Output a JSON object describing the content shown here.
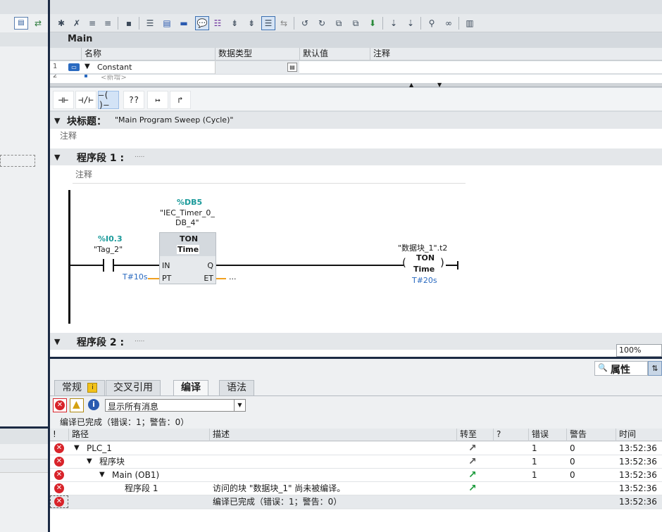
{
  "editor_header": {
    "block_name": "Main"
  },
  "interface": {
    "columns": [
      "名称",
      "数据类型",
      "默认值",
      "注释"
    ],
    "rows": [
      {
        "num": "1",
        "name": "Constant"
      },
      {
        "num": "2",
        "name": "<新增>"
      }
    ]
  },
  "lad_toolbar": [
    "⊣⊢",
    "⊣/⊢",
    "–( )–",
    "??",
    "↦",
    "↱"
  ],
  "block_title": {
    "label": "块标题：",
    "value": "\"Main Program Sweep (Cycle)\"",
    "comment": "注释"
  },
  "network1": {
    "label": "程序段 1 :",
    "title": ".....",
    "comment": "注释",
    "contact": {
      "address": "%I0.3",
      "tag": "\"Tag_2\""
    },
    "timer": {
      "db_address": "%DB5",
      "db_name_line1": "\"IEC_Timer_0_",
      "db_name_line2": "DB_4\"",
      "type": "TON",
      "time_label": "Time",
      "pin_in": "IN",
      "pin_pt": "PT",
      "pin_q": "Q",
      "pin_et": "ET",
      "pt_value": "T#10s",
      "et_value": "..."
    },
    "coil": {
      "tag": "\"数据块_1\".t2",
      "type": "TON",
      "time_label": "Time",
      "value": "T#20s"
    }
  },
  "network2": {
    "label": "程序段 2 :",
    "title": "....."
  },
  "zoom": "100%",
  "properties_button": "属性",
  "inspector_tabs": [
    {
      "label": "常规",
      "active": false
    },
    {
      "label": "交叉引用",
      "active": false
    },
    {
      "label": "编译",
      "active": true
    },
    {
      "label": "语法",
      "active": false
    }
  ],
  "filter": {
    "selected": "显示所有消息"
  },
  "compile_summary": "编译已完成（错误：1；警告：0）",
  "grid": {
    "columns": [
      "!",
      "路径",
      "描述",
      "转至",
      "?",
      "错误",
      "警告",
      "时间"
    ],
    "rows": [
      {
        "path": "PLC_1",
        "indent": 1,
        "expand": true,
        "desc": "",
        "goto": true,
        "errors": "1",
        "warnings": "0",
        "time": "13:52:36"
      },
      {
        "path": "程序块",
        "indent": 2,
        "expand": true,
        "desc": "",
        "goto": true,
        "errors": "1",
        "warnings": "0",
        "time": "13:52:36"
      },
      {
        "path": "Main (OB1)",
        "indent": 3,
        "expand": true,
        "desc": "",
        "goto": true,
        "errors": "1",
        "warnings": "0",
        "time": "13:52:36"
      },
      {
        "path": "程序段 1",
        "indent": 4,
        "expand": false,
        "desc": "访问的块 \"数据块_1\" 尚未被编译。",
        "goto": true,
        "errors": "",
        "warnings": "",
        "time": "13:52:36"
      },
      {
        "path": "",
        "indent": 0,
        "expand": false,
        "desc": "编译已完成（错误：1；警告：0）",
        "goto": false,
        "errors": "",
        "warnings": "",
        "time": "13:52:36"
      }
    ]
  },
  "colors": {
    "accent": "#3a6fb0",
    "error": "#d8232a",
    "teal": "#1a9a9a",
    "navy": "#1b2a44"
  }
}
